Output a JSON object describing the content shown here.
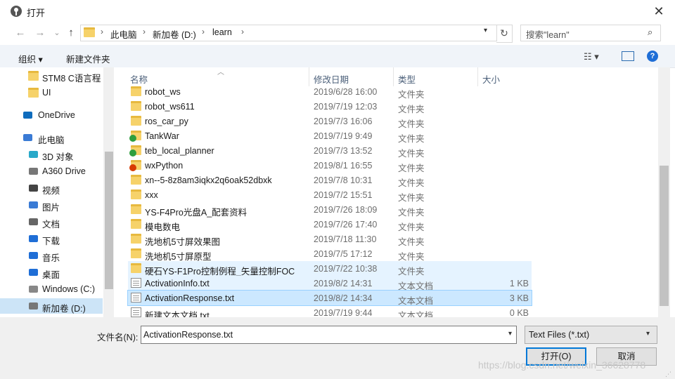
{
  "window": {
    "title": "打开",
    "close": "✕"
  },
  "nav": {
    "back": "←",
    "forward": "→",
    "up": "↑",
    "refresh": "↻"
  },
  "address": {
    "crumbs": [
      "此电脑",
      "新加卷 (D:)",
      "learn"
    ],
    "separator": "›"
  },
  "search": {
    "placeholder": "搜索\"learn\"",
    "icon": "⌕"
  },
  "toolbar": {
    "organize": "组织 ▾",
    "new_folder": "新建文件夹",
    "view": "☷ ▾",
    "help": "?"
  },
  "sidebar": {
    "items": [
      {
        "label": "STM8   C语言程",
        "icon": "folder-icon",
        "level": 2
      },
      {
        "label": "UI",
        "icon": "folder-icon",
        "level": 2
      },
      {
        "label": "OneDrive",
        "icon": "cloud-icon",
        "level": 1
      },
      {
        "label": "此电脑",
        "icon": "computer-icon",
        "level": 1
      },
      {
        "label": "3D 对象",
        "icon": "cube-icon",
        "level": 2
      },
      {
        "label": "A360 Drive",
        "icon": "drive-icon",
        "level": 2
      },
      {
        "label": "视频",
        "icon": "video-icon",
        "level": 2
      },
      {
        "label": "图片",
        "icon": "pictures-icon",
        "level": 2
      },
      {
        "label": "文档",
        "icon": "documents-icon",
        "level": 2
      },
      {
        "label": "下载",
        "icon": "download-icon",
        "level": 2
      },
      {
        "label": "音乐",
        "icon": "music-icon",
        "level": 2
      },
      {
        "label": "桌面",
        "icon": "desktop-icon",
        "level": 2
      },
      {
        "label": "Windows (C:)",
        "icon": "windows-drive-icon",
        "level": 2
      },
      {
        "label": "新加卷 (D:)",
        "icon": "drive-icon",
        "level": 2,
        "selected": true
      }
    ]
  },
  "columns": {
    "name": "名称",
    "date": "修改日期",
    "type": "类型",
    "size": "大小"
  },
  "files": [
    {
      "name": "robot_ws",
      "date": "2019/6/28 16:00",
      "type": "文件夹",
      "size": "",
      "icon": "folder-icon"
    },
    {
      "name": "robot_ws611",
      "date": "2019/7/19 12:03",
      "type": "文件夹",
      "size": "",
      "icon": "folder-icon"
    },
    {
      "name": "ros_car_py",
      "date": "2019/7/3 16:06",
      "type": "文件夹",
      "size": "",
      "icon": "folder-icon"
    },
    {
      "name": "TankWar",
      "date": "2019/7/19 9:49",
      "type": "文件夹",
      "size": "",
      "icon": "git-clean-folder-icon"
    },
    {
      "name": "teb_local_planner",
      "date": "2019/7/3 13:52",
      "type": "文件夹",
      "size": "",
      "icon": "git-clean-folder-icon"
    },
    {
      "name": "wxPython",
      "date": "2019/8/1 16:55",
      "type": "文件夹",
      "size": "",
      "icon": "git-modified-folder-icon"
    },
    {
      "name": "xn--5-8z8am3iqkx2q6oak52dbxk",
      "date": "2019/7/8 10:31",
      "type": "文件夹",
      "size": "",
      "icon": "folder-icon"
    },
    {
      "name": "xxx",
      "date": "2019/7/2 15:51",
      "type": "文件夹",
      "size": "",
      "icon": "folder-icon"
    },
    {
      "name": "YS-F4Pro光盘A_配套资料",
      "date": "2019/7/26 18:09",
      "type": "文件夹",
      "size": "",
      "icon": "folder-icon"
    },
    {
      "name": "模电数电",
      "date": "2019/7/26 17:40",
      "type": "文件夹",
      "size": "",
      "icon": "folder-icon"
    },
    {
      "name": "洗地机5寸屏效果图",
      "date": "2019/7/18 11:30",
      "type": "文件夹",
      "size": "",
      "icon": "folder-icon"
    },
    {
      "name": "洗地机5寸屏原型",
      "date": "2019/7/5 17:12",
      "type": "文件夹",
      "size": "",
      "icon": "folder-icon"
    },
    {
      "name": "硬石YS-F1Pro控制例程_矢量控制FOC",
      "date": "2019/7/22 10:38",
      "type": "文件夹",
      "size": "",
      "icon": "folder-icon",
      "hover": true
    },
    {
      "name": "ActivationInfo.txt",
      "date": "2019/8/2 14:31",
      "type": "文本文档",
      "size": "1 KB",
      "icon": "text-file-icon",
      "hover": true
    },
    {
      "name": "ActivationResponse.txt",
      "date": "2019/8/2 14:34",
      "type": "文本文档",
      "size": "3 KB",
      "icon": "text-file-icon",
      "selected": true
    },
    {
      "name": "新建文本文档.txt",
      "date": "2019/7/19 9:44",
      "type": "文本文档",
      "size": "0 KB",
      "icon": "text-file-icon"
    }
  ],
  "footer": {
    "filename_label": "文件名(N):",
    "filename_value": "ActivationResponse.txt",
    "filter_value": "Text Files (*.txt)",
    "open": "打开(O)",
    "cancel": "取消"
  },
  "watermark": "https://blog.csdn.net/weixin_36628778",
  "colors": {
    "selection": "#cce8ff",
    "hover": "#e5f3ff",
    "accent": "#0078d7",
    "folder": "#f6d26a"
  }
}
